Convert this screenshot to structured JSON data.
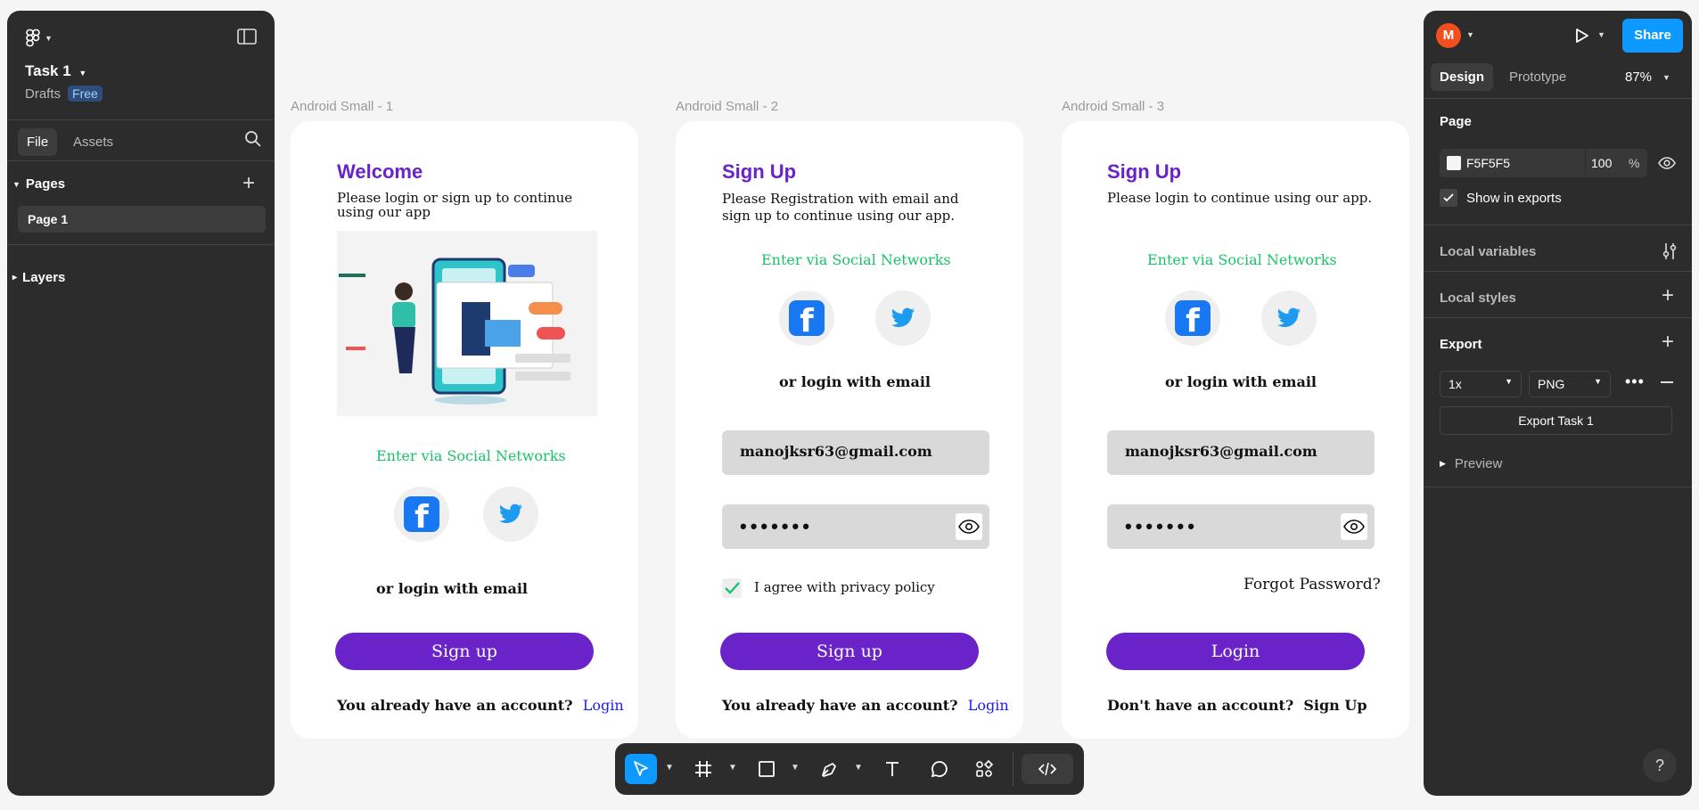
{
  "left_panel": {
    "file_name": "Task 1",
    "drafts_label": "Drafts",
    "plan_badge": "Free",
    "tabs": {
      "file": "File",
      "assets": "Assets"
    },
    "pages_label": "Pages",
    "page_item": "Page 1",
    "layers_label": "Layers"
  },
  "frames": {
    "f1": {
      "label": "Android Small - 1",
      "title": "Welcome",
      "subtitle": "Please login or sign up to continue using our app",
      "social_title": "Enter via  Social Networks",
      "or_login": "or login with email",
      "button": "Sign up",
      "bottom_text": "You already have an account?",
      "bottom_link": "Login"
    },
    "f2": {
      "label": "Android Small - 2",
      "title": "Sign Up",
      "subtitle": "Please Registration with email and  sign up to continue using our app.",
      "social_title": "Enter via  Social Networks",
      "or_login": "or login with email",
      "email": "manojksr63@gmail.com",
      "password": "•••••••",
      "agree": "I agree with privacy policy",
      "button": "Sign up",
      "bottom_text": "You already have an account?",
      "bottom_link": "Login"
    },
    "f3": {
      "label": "Android Small - 3",
      "title": "Sign Up",
      "subtitle": "Please login to continue using our app.",
      "social_title": "Enter via  Social Networks",
      "or_login": "or login with email",
      "email": "manojksr63@gmail.com",
      "password": "•••••••",
      "forgot": "Forgot Password?",
      "button": "Login",
      "bottom_text": "Don't have an account?",
      "bottom_link": "Sign Up"
    }
  },
  "right_panel": {
    "avatar_letter": "M",
    "share": "Share",
    "tabs": {
      "design": "Design",
      "prototype": "Prototype"
    },
    "zoom": "87%",
    "page_section": "Page",
    "page_color": "F5F5F5",
    "page_opacity": "100",
    "percent": "%",
    "show_in_exports": "Show in exports",
    "local_variables": "Local variables",
    "local_styles": "Local styles",
    "export_section": "Export",
    "export_scale": "1x",
    "export_format": "PNG",
    "export_button": "Export Task 1",
    "preview": "Preview"
  },
  "help": "?",
  "colors": {
    "accent": "#0d99ff",
    "brand_purple": "#6a22c9",
    "social_green": "#19c36b",
    "panel": "#2c2c2c"
  }
}
